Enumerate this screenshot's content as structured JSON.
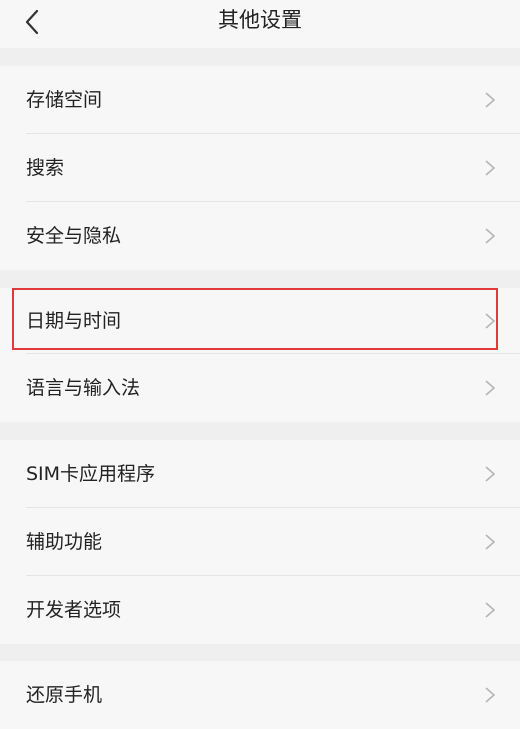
{
  "header": {
    "title": "其他设置",
    "back_icon": "chevron-left-icon"
  },
  "groups": [
    {
      "items": [
        {
          "label": "存储空间"
        },
        {
          "label": "搜索"
        },
        {
          "label": "安全与隐私"
        }
      ]
    },
    {
      "items": [
        {
          "label": "日期与时间",
          "highlighted": true
        },
        {
          "label": "语言与输入法"
        }
      ]
    },
    {
      "items": [
        {
          "label": "SIM卡应用程序"
        },
        {
          "label": "辅助功能"
        },
        {
          "label": "开发者选项"
        }
      ]
    },
    {
      "items": [
        {
          "label": "还原手机"
        }
      ]
    }
  ],
  "colors": {
    "highlight_border": "#e23a3a",
    "background": "#efefef",
    "row_background": "#f7f7f7"
  },
  "row_chevron_icon": "chevron-right-icon"
}
